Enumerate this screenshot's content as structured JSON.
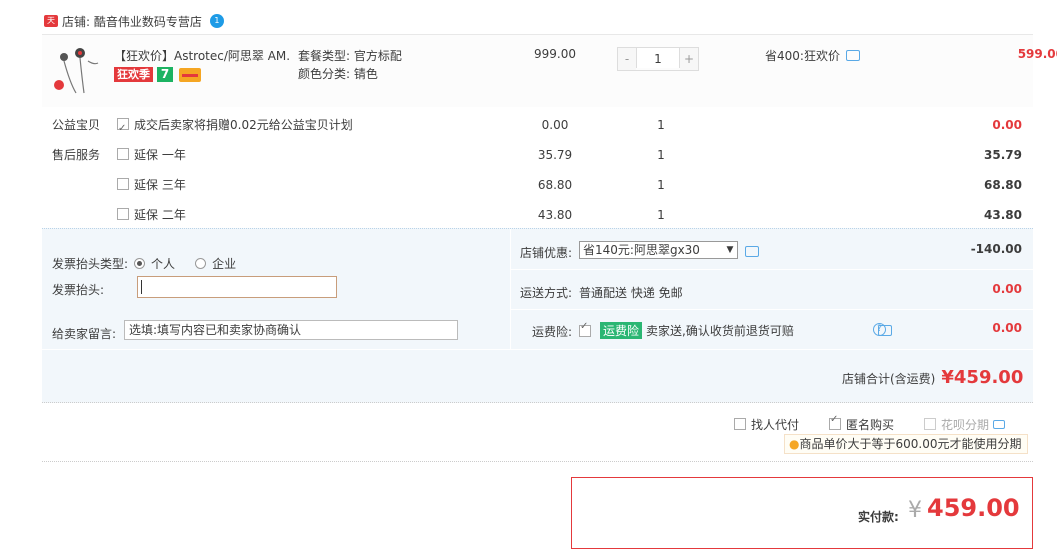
{
  "store": {
    "badge": "天猫",
    "name": "店铺: 酷音伟业数码专营店",
    "ww": "1"
  },
  "item": {
    "title": "【狂欢价】Astrotec/阿思翠 AM...",
    "tag_promo": "狂欢季",
    "tag_seven": "7",
    "sku_plan": "套餐类型: 官方标配",
    "sku_color": "颜色分类: 锖色",
    "price": "999.00",
    "qty_minus": "-",
    "qty": "1",
    "qty_plus": "+",
    "save_text": "省400:狂欢价",
    "total": "599.00"
  },
  "services": [
    {
      "label": "公益宝贝",
      "desc": "成交后卖家将捐赠0.02元给公益宝贝计划",
      "checked": true,
      "price": "0.00",
      "qty": "1",
      "total": "0.00"
    },
    {
      "label": "售后服务",
      "desc": "延保 一年",
      "checked": false,
      "price": "35.79",
      "qty": "1",
      "total": "35.79"
    },
    {
      "label": "",
      "desc": "延保 三年",
      "checked": false,
      "price": "68.80",
      "qty": "1",
      "total": "68.80"
    },
    {
      "label": "",
      "desc": "延保 二年",
      "checked": false,
      "price": "43.80",
      "qty": "1",
      "total": "43.80"
    }
  ],
  "invoice": {
    "type_label": "发票抬头类型:",
    "opt_personal": "个人",
    "opt_company": "企业",
    "head_label": "发票抬头:"
  },
  "message": {
    "label": "给卖家留言:",
    "placeholder": "选填:填写内容已和卖家协商确认"
  },
  "discount": {
    "label": "店铺优惠:",
    "selected": "省140元:阿思翠gx30",
    "amount": "-140.00"
  },
  "shipping": {
    "label": "运送方式:",
    "value": "普通配送 快递 免邮",
    "amount": "0.00"
  },
  "insurance": {
    "label": "运费险:",
    "badge": "运费险",
    "text": "卖家送,确认收货前退货可赔",
    "amount": "0.00"
  },
  "store_total": {
    "label": "店铺合计(含运费)",
    "amount": "¥459.00"
  },
  "options": {
    "find_payer": "找人代付",
    "anonymous": "匿名购买",
    "installment": "花呗分期",
    "installment_tip": "商品单价大于等于600.00元才能使用分期"
  },
  "payment": {
    "label": "实付款:",
    "currency": "¥",
    "amount": "459.00"
  }
}
